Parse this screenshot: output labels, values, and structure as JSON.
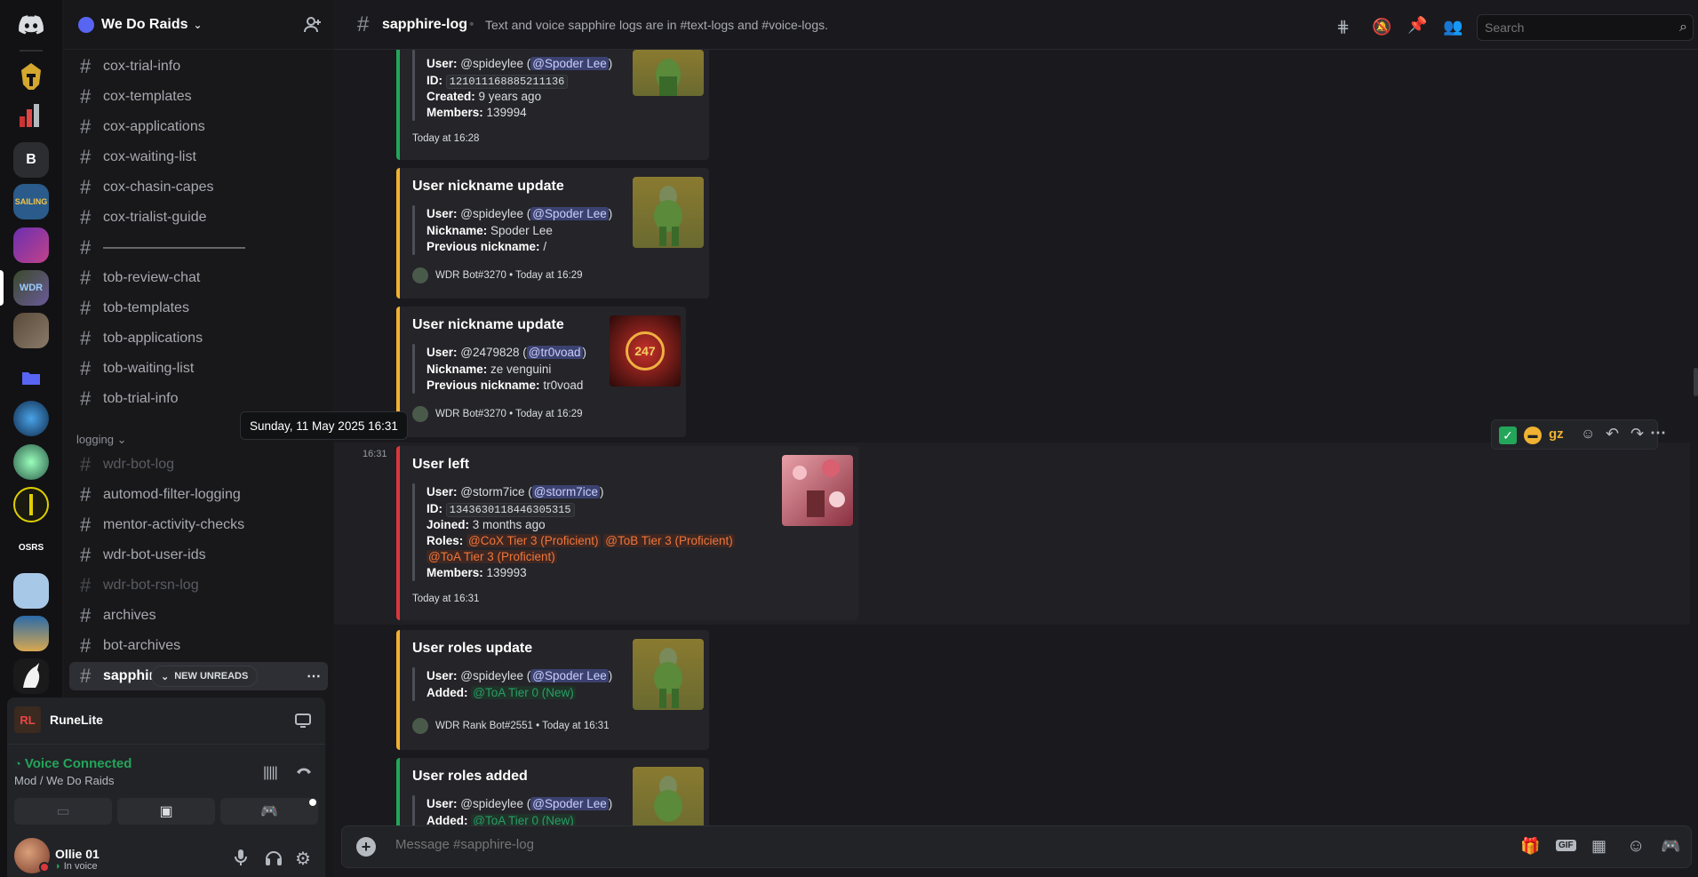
{
  "server": {
    "name": "We Do Raids"
  },
  "guild_letter": "B",
  "channels": [
    {
      "name": "cox-trial-info",
      "dim": false
    },
    {
      "name": "cox-templates",
      "dim": false
    },
    {
      "name": "cox-applications",
      "dim": false
    },
    {
      "name": "cox-waiting-list",
      "dim": false
    },
    {
      "name": "cox-chasin-capes",
      "dim": false
    },
    {
      "name": "cox-trialist-guide",
      "dim": false
    },
    {
      "name": "——————————",
      "dim": false
    },
    {
      "name": "tob-review-chat",
      "dim": false
    },
    {
      "name": "tob-templates",
      "dim": false
    },
    {
      "name": "tob-applications",
      "dim": false
    },
    {
      "name": "tob-waiting-list",
      "dim": false
    },
    {
      "name": "tob-trial-info",
      "dim": false
    }
  ],
  "category": "logging",
  "logging_channels": [
    {
      "name": "wdr-bot-log",
      "dim": true
    },
    {
      "name": "automod-filter-logging",
      "dim": false
    },
    {
      "name": "mentor-activity-checks",
      "dim": false
    },
    {
      "name": "wdr-bot-user-ids",
      "dim": false
    },
    {
      "name": "wdr-bot-rsn-log",
      "dim": true
    },
    {
      "name": "archives",
      "dim": false
    },
    {
      "name": "bot-archives",
      "dim": false
    }
  ],
  "active_channel": "sapphir",
  "new_unreads": "NEW UNREADS",
  "activity": {
    "name": "RuneLite"
  },
  "voice": {
    "status": "Voice Connected",
    "location": "Mod / We Do Raids"
  },
  "user": {
    "name": "Ollie 01",
    "status": "In voice"
  },
  "topbar": {
    "channel": "sapphire-log",
    "topic": "Text and voice sapphire logs are in #text-logs and #voice-logs.",
    "search_placeholder": "Search"
  },
  "tooltip": "Sunday, 11 May 2025 16:31",
  "msg_time": "16:31",
  "embeds": {
    "e1": {
      "user_label": "User:",
      "user_val": "@spideylee (",
      "user_mention": "@Spoder Lee",
      "close": ")",
      "id_label": "ID:",
      "id_val": "121011168885211136",
      "created_label": "Created:",
      "created_val": "9 years ago",
      "members_label": "Members:",
      "members_val": "139994",
      "footer": "Today at 16:28"
    },
    "e2": {
      "title": "User nickname update",
      "user_label": "User:",
      "user_val": "@spideylee (",
      "user_mention": "@Spoder Lee",
      "close": ")",
      "nick_label": "Nickname:",
      "nick_val": "Spoder Lee",
      "prev_label": "Previous nickname:",
      "prev_val": "/",
      "footer": "WDR Bot#3270 • Today at 16:29"
    },
    "e3": {
      "title": "User nickname update",
      "user_label": "User:",
      "user_val": "@2479828 (",
      "user_mention": "@tr0voad",
      "close": ")",
      "nick_label": "Nickname:",
      "nick_val": "ze venguini",
      "prev_label": "Previous nickname:",
      "prev_val": "tr0voad",
      "footer": "WDR Bot#3270 • Today at 16:29",
      "thumb_text": "247"
    },
    "e4": {
      "title": "User left",
      "user_label": "User:",
      "user_val": "@storm7ice (",
      "user_mention": "@storm7ice",
      "close": ")",
      "id_label": "ID:",
      "id_val": "1343630118446305315",
      "joined_label": "Joined:",
      "joined_val": "3 months ago",
      "roles_label": "Roles:",
      "role1": "@CoX Tier 3 (Proficient)",
      "role2": "@ToB Tier 3 (Proficient)",
      "role3": "@ToA Tier 3 (Proficient)",
      "members_label": "Members:",
      "members_val": "139993",
      "footer": "Today at 16:31"
    },
    "e5": {
      "title": "User roles update",
      "user_label": "User:",
      "user_val": "@spideylee (",
      "user_mention": "@Spoder Lee",
      "close": ")",
      "added_label": "Added:",
      "added_val": "@ToA Tier 0 (New)",
      "footer": "WDR Rank Bot#2551 • Today at 16:31"
    },
    "e6": {
      "title": "User roles added",
      "user_label": "User:",
      "user_val": "@spideylee (",
      "user_mention": "@Spoder Lee",
      "close": ")",
      "added_label": "Added:",
      "added_val": "@ToA Tier 0 (New)"
    }
  },
  "reactions": {
    "r3": "gz"
  },
  "composer": {
    "placeholder": "Message #sapphire-log"
  },
  "colors": {
    "green": "#23a55a",
    "yellow": "#f0b232",
    "red": "#da373c",
    "blurple": "#5865f2"
  }
}
